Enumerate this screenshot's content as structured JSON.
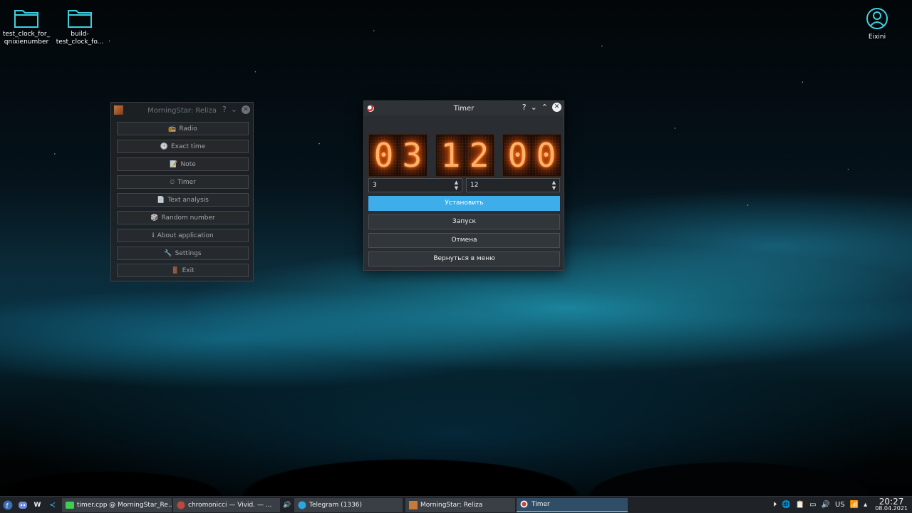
{
  "desktop": {
    "icons": [
      {
        "label": "test_clock_for_\nqnixienumber"
      },
      {
        "label": "build-\ntest_clock_fo..."
      }
    ],
    "user": {
      "label": "Eixini"
    }
  },
  "menu_window": {
    "title": "MorningStar: Reliza",
    "buttons": [
      {
        "icon": "📻",
        "label": "Radio"
      },
      {
        "icon": "🕒",
        "label": "Exact time"
      },
      {
        "icon": "📝",
        "label": "Note"
      },
      {
        "icon": "⏲",
        "label": "Timer"
      },
      {
        "icon": "📄",
        "label": "Text analysis"
      },
      {
        "icon": "🎲",
        "label": "Random number"
      },
      {
        "icon": "ℹ",
        "label": "About application"
      },
      {
        "icon": "🔧",
        "label": "Settings"
      },
      {
        "icon": "🚪",
        "label": "Exit"
      }
    ]
  },
  "timer_window": {
    "title": "Timer",
    "digits": [
      "0",
      "3",
      "1",
      "2",
      "0",
      "0"
    ],
    "spin_minutes": "3",
    "spin_seconds": "12",
    "buttons": {
      "set": "Установить",
      "start": "Запуск",
      "cancel": "Отмена",
      "back": "Вернуться в меню"
    }
  },
  "taskbar": {
    "tasks": [
      {
        "label": "timer.cpp @ MorningStar_Re...",
        "icon": "qt-creator-icon"
      },
      {
        "label": "chromonicci — Vivid. — ...",
        "icon": "firefox-icon"
      },
      {
        "label": "Telegram (1336)",
        "icon": "telegram-icon"
      },
      {
        "label": "MorningStar: Reliza",
        "icon": "morningstar-icon"
      },
      {
        "label": "Timer",
        "icon": "timer-icon"
      }
    ],
    "keyboard_layout": "US",
    "time": "20:27",
    "date": "08.04.2021",
    "accent_color": "#3daee9"
  }
}
